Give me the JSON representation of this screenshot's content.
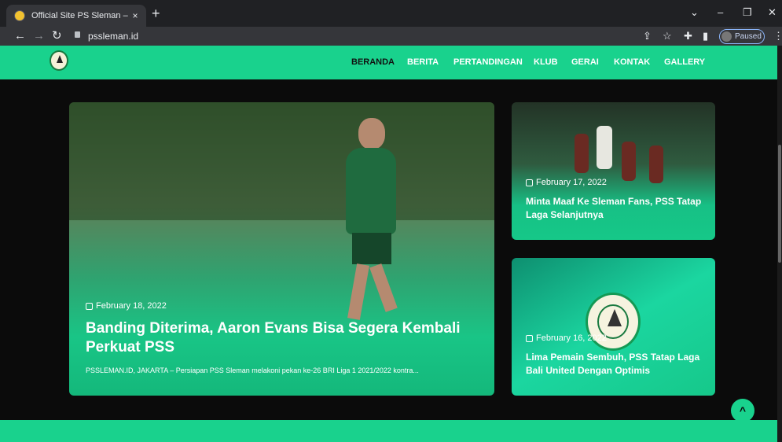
{
  "browser": {
    "tab_title": "Official Site PS Sleman – PS Slem",
    "tab_close": "×",
    "new_tab": "+",
    "url": "pssleman.id",
    "profile_label": "Paused",
    "win_min": "–",
    "win_max": "❐",
    "win_close": "✕",
    "tab_search": "⌄"
  },
  "site": {
    "nav": [
      "BERANDA",
      "BERITA",
      "PERTANDINGAN",
      "KLUB",
      "GERAI",
      "KONTAK",
      "GALLERY"
    ]
  },
  "featured": {
    "date": "February 18, 2022",
    "title": "Banding Diterima, Aaron Evans Bisa Segera Kembali Perkuat PSS",
    "excerpt": "PSSLEMAN.ID, JAKARTA – Persiapan PSS Sleman melakoni pekan ke-26 BRI Liga 1 2021/2022 kontra..."
  },
  "side_posts": [
    {
      "date": "February 17, 2022",
      "title": "Minta Maaf Ke Sleman Fans, PSS Tatap Laga Selanjutnya"
    },
    {
      "date": "February 16, 2022",
      "title": "Lima Pemain Sembuh, PSS Tatap Laga Bali United Dengan Optimis"
    }
  ],
  "to_top": "^",
  "colors": {
    "brand": "#19d28d",
    "background": "#0b0b0b"
  }
}
